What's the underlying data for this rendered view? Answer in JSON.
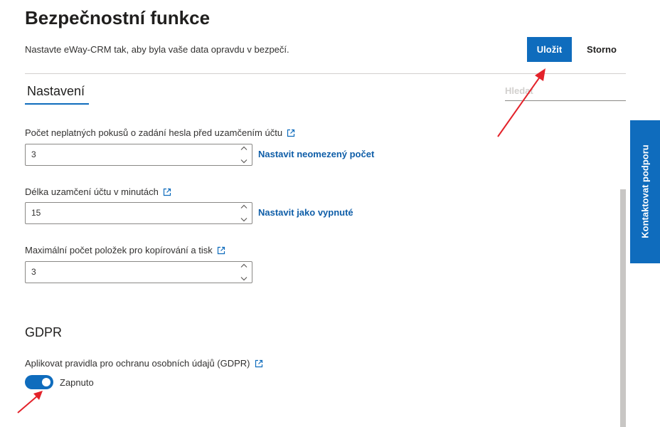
{
  "header": {
    "title": "Bezpečnostní funkce",
    "subtitle": "Nastavte eWay-CRM tak, aby byla vaše data opravdu v bezpečí.",
    "save_label": "Uložit",
    "cancel_label": "Storno"
  },
  "tabs": [
    {
      "label": "Nastavení",
      "selected": true
    }
  ],
  "search": {
    "placeholder": "Hledat",
    "value": ""
  },
  "settings": {
    "fields": [
      {
        "label": "Počet neplatných pokusů o zadání hesla před uzamčením účtu",
        "value": "3",
        "link": "Nastavit neomezený počet"
      },
      {
        "label": "Délka uzamčení účtu v minutách",
        "value": "15",
        "link": "Nastavit jako vypnuté"
      },
      {
        "label": "Maximální počet položek pro kopírování a tisk",
        "value": "3",
        "link": ""
      }
    ]
  },
  "gdpr": {
    "heading": "GDPR",
    "label": "Aplikovat pravidla pro ochranu osobních údajů (GDPR)",
    "toggle_on": true,
    "toggle_label": "Zapnuto"
  },
  "support": {
    "label": "Kontaktovat podporu"
  },
  "icons": {
    "external_link": "external-link-icon",
    "spinner_up": "chevron-up-icon",
    "spinner_down": "chevron-down-icon"
  },
  "colors": {
    "accent": "#0f6cbd",
    "link": "#0f5ea8",
    "annotation": "#e3222a"
  }
}
